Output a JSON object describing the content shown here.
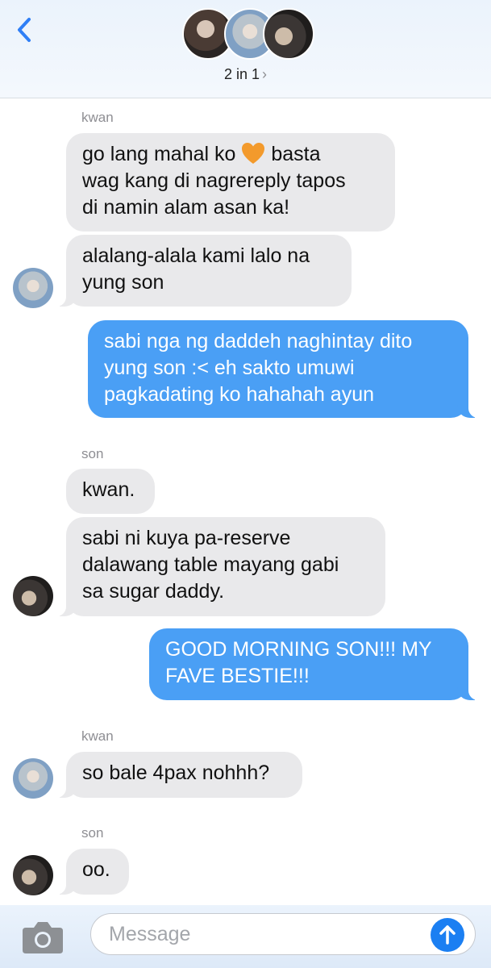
{
  "header": {
    "title": "2 in 1",
    "chevron": "›",
    "back_icon": "chevron-left-icon",
    "avatars": [
      "avatar-1",
      "avatar-2",
      "avatar-3"
    ]
  },
  "messages": [
    {
      "sender": "kwan"
    },
    {
      "direction": "incoming",
      "lines": [
        "go lang mahal ko",
        "basta",
        "wag kang di nagrereply tapos",
        "di namin alam asan ka!"
      ],
      "emoji": "orange-heart"
    },
    {
      "direction": "incoming",
      "lines": [
        "alalang-alala kami lalo na",
        "yung son"
      ]
    },
    {
      "direction": "outgoing",
      "lines": [
        "sabi nga ng daddeh naghintay dito",
        "yung son :< eh sakto umuwi",
        "pagkadating ko hahahah ayun"
      ]
    },
    {
      "sender": "son"
    },
    {
      "direction": "incoming",
      "lines": [
        "kwan."
      ]
    },
    {
      "direction": "incoming",
      "lines": [
        "sabi ni kuya pa-reserve",
        "dalawang table mayang gabi",
        "sa sugar daddy."
      ]
    },
    {
      "direction": "outgoing",
      "lines": [
        "GOOD MORNING SON!!! MY",
        "FAVE BESTIE!!!"
      ]
    },
    {
      "sender": "kwan"
    },
    {
      "direction": "incoming",
      "lines": [
        "so bale 4pax nohhh?"
      ]
    },
    {
      "sender": "son"
    },
    {
      "direction": "incoming",
      "lines": [
        "oo."
      ]
    }
  ],
  "footer": {
    "placeholder": "Message",
    "camera_icon": "camera-icon",
    "send_icon": "arrow-up-icon"
  },
  "colors": {
    "incoming_bubble": "#e9e9eb",
    "outgoing_bubble": "#4a9ff5",
    "accent": "#1b7ff2"
  }
}
